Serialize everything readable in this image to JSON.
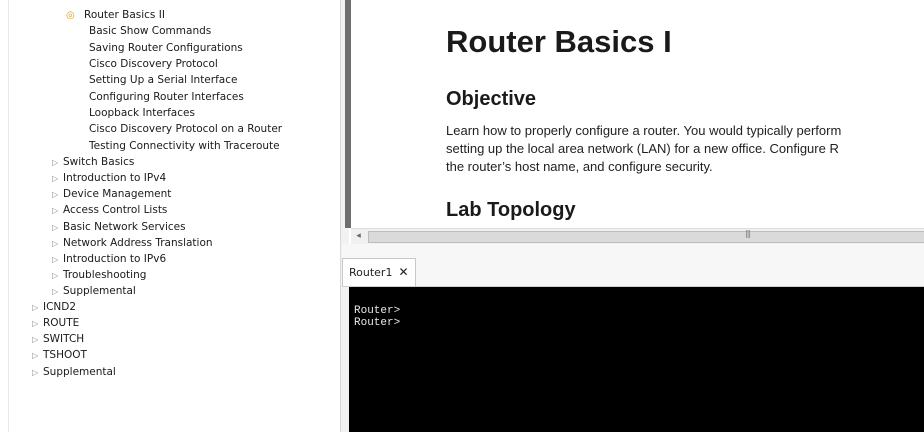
{
  "tree": {
    "items": [
      {
        "label": "Router Basics II",
        "current": true
      },
      {
        "label": "Basic Show Commands"
      },
      {
        "label": "Saving Router Configurations"
      },
      {
        "label": "Cisco Discovery Protocol"
      },
      {
        "label": "Setting Up a Serial Interface"
      },
      {
        "label": "Configuring Router Interfaces"
      },
      {
        "label": "Loopback Interfaces"
      },
      {
        "label": "Cisco Discovery Protocol on a Router"
      },
      {
        "label": "Testing Connectivity with Traceroute"
      },
      {
        "label": "Switch Basics",
        "collapsed": true
      },
      {
        "label": "Introduction to IPv4",
        "collapsed": true
      },
      {
        "label": "Device Management",
        "collapsed": true
      },
      {
        "label": "Access Control Lists",
        "collapsed": true
      },
      {
        "label": "Basic Network Services",
        "collapsed": true
      },
      {
        "label": "Network Address Translation",
        "collapsed": true
      },
      {
        "label": "Introduction to IPv6",
        "collapsed": true
      },
      {
        "label": "Troubleshooting",
        "collapsed": true
      },
      {
        "label": "Supplemental",
        "collapsed": true
      },
      {
        "label": "ICND2",
        "collapsed": true
      },
      {
        "label": "ROUTE",
        "collapsed": true
      },
      {
        "label": "SWITCH",
        "collapsed": true
      },
      {
        "label": "TSHOOT",
        "collapsed": true
      },
      {
        "label": "Supplemental",
        "collapsed": true
      }
    ]
  },
  "document": {
    "title": "Router Basics I",
    "objective_heading": "Objective",
    "objective_lines": [
      "Learn how to properly configure a router. You would typically perform",
      "setting up the local area network (LAN) for a new office. Configure R",
      "the router’s host name, and configure security."
    ],
    "topology_heading": "Lab Topology"
  },
  "scrollbar": {
    "left_arrow": "◂",
    "grip": "|||"
  },
  "tabs": [
    {
      "label": "Router1",
      "close": "✕",
      "active": true
    }
  ],
  "terminal": {
    "output": "Router>\nRouter>"
  },
  "icons": {
    "collapsed": "▷",
    "current": "◎"
  }
}
